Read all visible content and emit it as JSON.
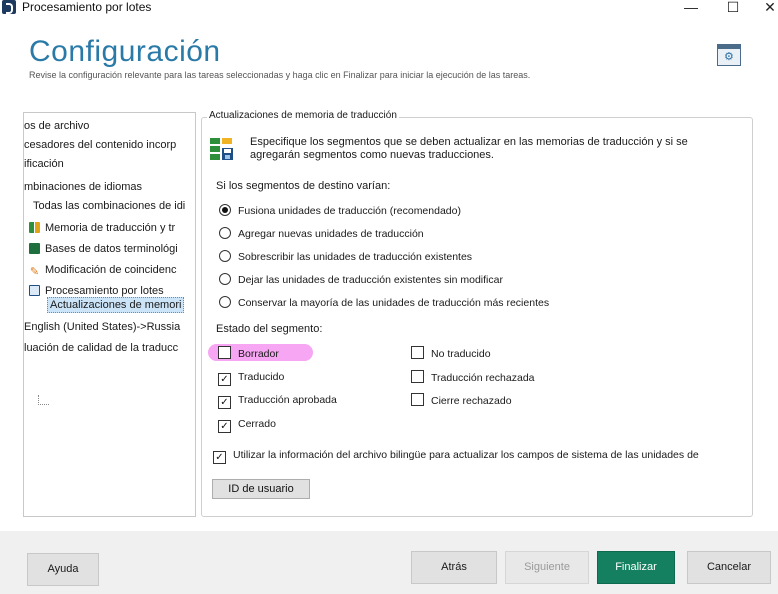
{
  "window": {
    "title": "Procesamiento por lotes",
    "minimize": "—",
    "maximize": "☐",
    "close": "✕"
  },
  "header": {
    "title": "Configuración",
    "subtitle": "Revise la configuración relevante para las tareas seleccionadas y haga clic en Finalizar para iniciar la ejecución de las tareas.",
    "settings_icon": "⚙"
  },
  "tree": {
    "items": [
      {
        "label": "os de archivo",
        "icon": ""
      },
      {
        "label": "cesadores del contenido incorp",
        "icon": ""
      },
      {
        "label": "ificación",
        "icon": ""
      },
      {
        "label": "mbinaciones de idiomas",
        "icon": ""
      },
      {
        "label": "Todas las combinaciones de idi",
        "icon": ""
      },
      {
        "label": "Memoria de traducción y tr",
        "icon": "tm-icon"
      },
      {
        "label": "Bases de datos terminológi",
        "icon": "termbase-icon"
      },
      {
        "label": "Modificación de coincidenc",
        "icon": "wrench-icon"
      },
      {
        "label": "Procesamiento por lotes",
        "icon": "batch-icon"
      },
      {
        "label": "Actualizaciones de memori",
        "icon": ""
      },
      {
        "label": "English (United States)->Russia",
        "icon": ""
      },
      {
        "label": "luación de calidad de la traducc",
        "icon": ""
      }
    ]
  },
  "panel": {
    "legend": "Actualizaciones de memoria de traducción",
    "description": "Especifique los segmentos que se deben actualizar en las memorias de traducción y si se agregarán segmentos como nuevas traducciones.",
    "target_label": "Si los segmentos de destino varían:",
    "radio_options": [
      {
        "label": "Fusiona unidades de traducción (recomendado)",
        "selected": true
      },
      {
        "label": "Agregar nuevas unidades de traducción",
        "selected": false
      },
      {
        "label": "Sobrescribir las unidades de traducción existentes",
        "selected": false
      },
      {
        "label": "Dejar las unidades de traducción existentes sin modificar",
        "selected": false
      },
      {
        "label": "Conservar la mayoría de las unidades de traducción más recientes",
        "selected": false
      }
    ],
    "status_label": "Estado del segmento:",
    "status_checks": [
      {
        "label": "Borrador",
        "checked": false
      },
      {
        "label": "Traducido",
        "checked": true
      },
      {
        "label": "Traducción aprobada",
        "checked": true
      },
      {
        "label": "Cerrado",
        "checked": true
      },
      {
        "label": "No traducido",
        "checked": false
      },
      {
        "label": "Traducción rechazada",
        "checked": false
      },
      {
        "label": "Cierre rechazado",
        "checked": false
      }
    ],
    "bilingual_check": {
      "label": "Utilizar la información del archivo bilingüe para actualizar los campos de sistema de las unidades de",
      "checked": true
    },
    "user_id_button": "ID de usuario"
  },
  "footer": {
    "help": "Ayuda",
    "back": "Atrás",
    "next": "Siguiente",
    "finish": "Finalizar",
    "cancel": "Cancelar"
  },
  "colors": {
    "heading": "#2a7aa8",
    "primary": "#14805f",
    "highlight": "#f6a6f2",
    "selected": "#cce4f7"
  },
  "checkmark": "✓"
}
